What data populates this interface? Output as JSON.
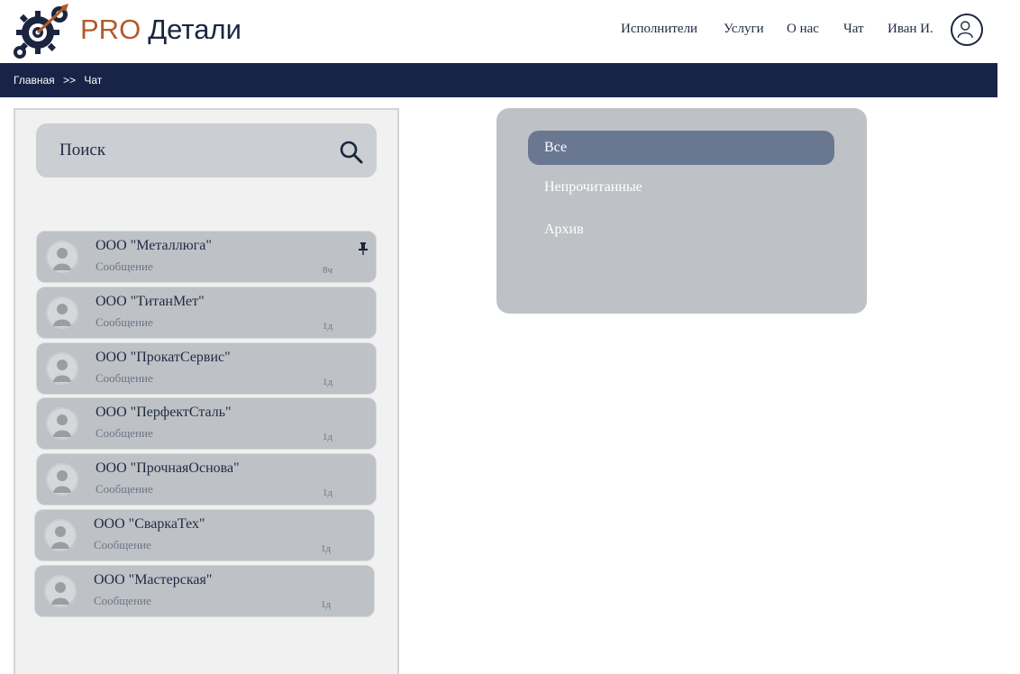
{
  "header": {
    "logo_pro": "PRO",
    "logo_name": "Детали",
    "nav": [
      "Исполнители",
      "Услуги",
      "О нас",
      "Чат",
      "Иван И."
    ],
    "user_icon": "user-circle-icon",
    "logo_icon": "gear-arrow-logo-icon"
  },
  "breadcrumb": {
    "home": "Главная",
    "separator": ">>",
    "current": "Чат"
  },
  "search": {
    "placeholder": "Поиск",
    "icon": "search-icon"
  },
  "chats": [
    {
      "name": "ООО \"Металлюга\"",
      "message": "Сообщение",
      "time": "8ч",
      "pinned": true
    },
    {
      "name": "ООО \"ТитанМет\"",
      "message": "Сообщение",
      "time": "1д",
      "pinned": false
    },
    {
      "name": "ООО \"ПрокатСервис\"",
      "message": "Сообщение",
      "time": "1д",
      "pinned": false
    },
    {
      "name": "ООО \"ПерфектСталь\"",
      "message": "Сообщение",
      "time": "1д",
      "pinned": false
    },
    {
      "name": "ООО \"ПрочнаяОснова\"",
      "message": "Сообщение",
      "time": "1д",
      "pinned": false
    },
    {
      "name": "ООО \"СваркаТех\"",
      "message": "Сообщение",
      "time": "1д",
      "pinned": false
    },
    {
      "name": "ООО \"Мастерская\"",
      "message": "Сообщение",
      "time": "1д",
      "pinned": false
    }
  ],
  "filters": [
    {
      "label": "Все",
      "active": true
    },
    {
      "label": "Непрочитанные",
      "active": false
    },
    {
      "label": "Архив",
      "active": false
    }
  ],
  "colors": {
    "brand_dark": "#182447",
    "brand_accent": "#b25a2b",
    "item_bg": "#bec1c5",
    "filter_active": "#6a7791"
  }
}
